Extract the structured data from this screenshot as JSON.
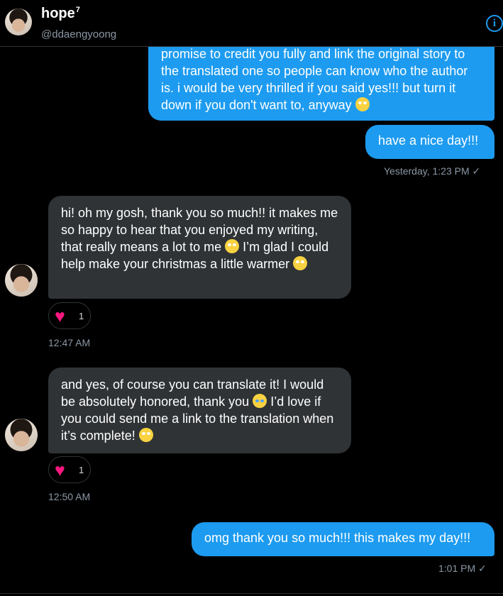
{
  "header": {
    "name": "hope",
    "name_sup": "7",
    "handle": "@ddaengyoong",
    "info_icon": "info-icon"
  },
  "messages": {
    "m1": "promise to credit you fully and link the original story to the translated one so people can know who the author is. i would be very thrilled if you said yes!!! but turn it down if you don't want to, anyway",
    "m2": "have a nice day!!!",
    "m2_time": "Yesterday, 1:23 PM ✓",
    "m3_a": "hi! oh my gosh, thank you so much!! it makes me so happy to hear that you enjoyed my writing, that really means a lot to me",
    "m3_b": " I’m glad I could help make your christmas a little warmer",
    "m3_count": "1",
    "m3_time": "12:47 AM",
    "m4_a": "and yes, of course you can translate it! I would be absolutely honored, thank you",
    "m4_b": " I’d love if you could send me a link to the translation when it’s complete!",
    "m4_count": "1",
    "m4_time": "12:50 AM",
    "m5": "omg thank you so much!!! this makes my day!!!",
    "m5_time": "1:01 PM ✓"
  },
  "colors": {
    "accent": "#1d9bf0",
    "incoming_bubble": "#2f3336",
    "heart": "#f91880"
  }
}
